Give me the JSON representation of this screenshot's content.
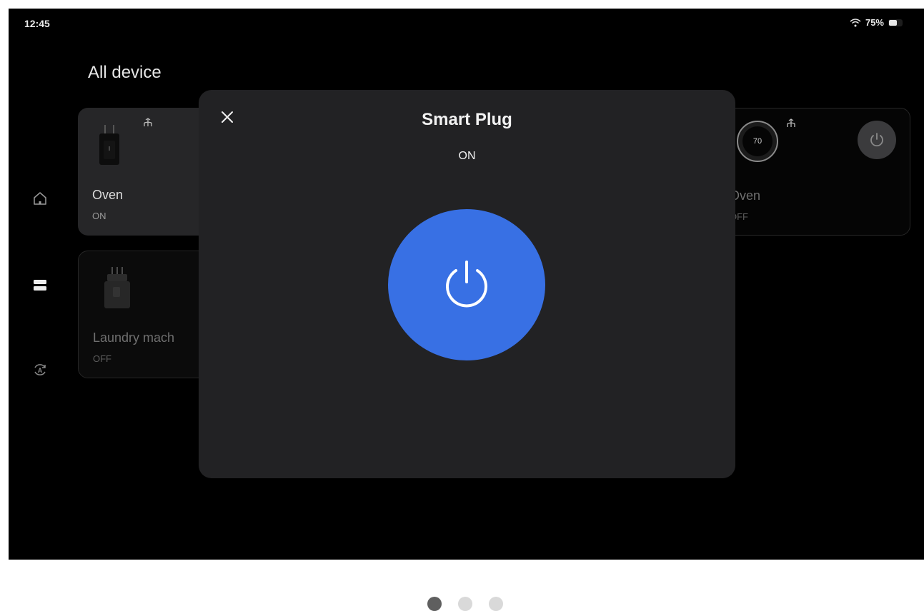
{
  "status_bar": {
    "time": "12:45",
    "battery": "75%"
  },
  "page": {
    "title": "All device"
  },
  "devices": [
    {
      "name": "Oven",
      "status": "ON"
    },
    {
      "name": "Laundry mach",
      "status": "OFF"
    },
    {
      "name": "Oven",
      "status": "OFF",
      "display_value": "70"
    }
  ],
  "modal": {
    "title": "Smart Plug",
    "status": "ON"
  },
  "colors": {
    "accent": "#3870e4",
    "modal_bg": "#222224",
    "card_active": "#262628"
  },
  "pagination": {
    "count": 3,
    "active_index": 0
  }
}
